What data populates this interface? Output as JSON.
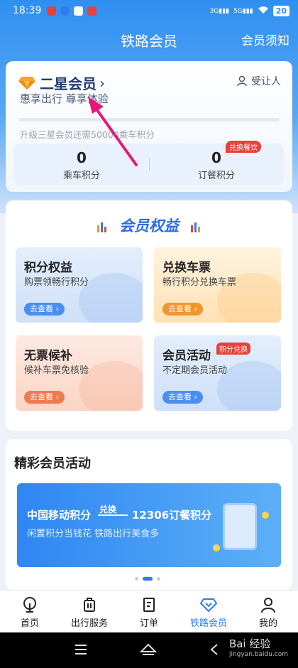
{
  "status_bar": {
    "time": "18:39",
    "battery": "20"
  },
  "header": {
    "title": "铁路会员",
    "notice_link": "会员须知"
  },
  "member": {
    "level_name": "二星会员",
    "slogan": "惠享出行 尊享体验",
    "transferee_label": "受让人",
    "progress": 0.0,
    "upgrade_text": "升级三星会员还需50000乘车积分",
    "ride_points_value": "0",
    "ride_points_label": "乘车积分",
    "meal_points_value": "0",
    "meal_points_label": "订餐积分",
    "meal_badge": "兑换餐饮"
  },
  "benefits": {
    "title": "会员权益",
    "tiles": [
      {
        "title": "积分权益",
        "subtitle": "购票领畅行积分",
        "button": "去查看"
      },
      {
        "title": "兑换车票",
        "subtitle": "畅行积分兑换车票",
        "button": "去查看"
      },
      {
        "title": "无票候补",
        "subtitle": "候补车票免核验",
        "button": "去查看"
      },
      {
        "title": "会员活动",
        "subtitle": "不定期会员活动",
        "button": "去查看",
        "tag": "积分兑换"
      }
    ]
  },
  "activities": {
    "title": "精彩会员活动",
    "banner": {
      "left_text": "中国移动积分",
      "arrow_text": "兑换",
      "right_text": "12306订餐积分",
      "subtitle": "闲置积分当钱花 铁路出行美食多"
    }
  },
  "nav": [
    {
      "label": "首页"
    },
    {
      "label": "出行服务"
    },
    {
      "label": "订单"
    },
    {
      "label": "铁路会员",
      "active": true
    },
    {
      "label": "我的"
    }
  ],
  "watermark": {
    "text": "Bai 经验",
    "sub": "jingyan.baidu.com"
  },
  "colors": {
    "primary": "#2d7cf0",
    "header_bg": "#2f8ff0",
    "badge_red": "#e8413a",
    "annotation": "#e6177a"
  }
}
